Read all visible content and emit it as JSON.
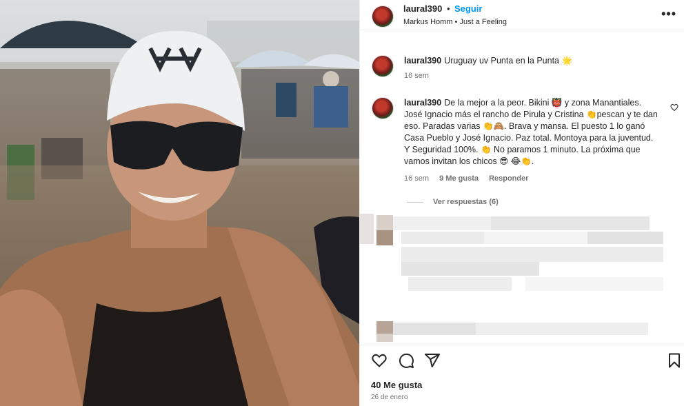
{
  "post": {
    "username": "laural390",
    "separator": "•",
    "follow_label": "Seguir",
    "audio": "Markus Homm • Just a Feeling",
    "caption_text": "Uruguay uv Punta en la Punta 🌟",
    "caption_time": "16 sem",
    "likes": "40 Me gusta",
    "date": "26 de enero"
  },
  "comment": {
    "username": "laural390",
    "text": "De la mejor a la peor. Bikini 👹 y zona Manantiales. José Ignacio más el rancho de Pirula y Cristina 👏pescan y te dan eso. Paradas varias 👏🙈. Brava y mansa. El puesto 1 lo ganó Casa Pueblo y José Ignacio. Paz total. Montoya para la juventud. Y Seguridad 100%. 👏 No paramos 1 minuto. La próxima que vamos invitan los chicos 😎 😂👏.",
    "time": "16 sem",
    "likes": "9 Me gusta",
    "reply_label": "Responder",
    "view_replies": "Ver respuestas (6)"
  },
  "icons": {
    "more": "more-options-icon",
    "like": "heart-icon",
    "comment": "comment-icon",
    "share": "share-icon",
    "save": "bookmark-icon",
    "comment_like": "heart-small-icon"
  },
  "colors": {
    "accent": "#0095f6",
    "text": "#262626",
    "secondary": "#737373",
    "divider": "#efefef"
  }
}
